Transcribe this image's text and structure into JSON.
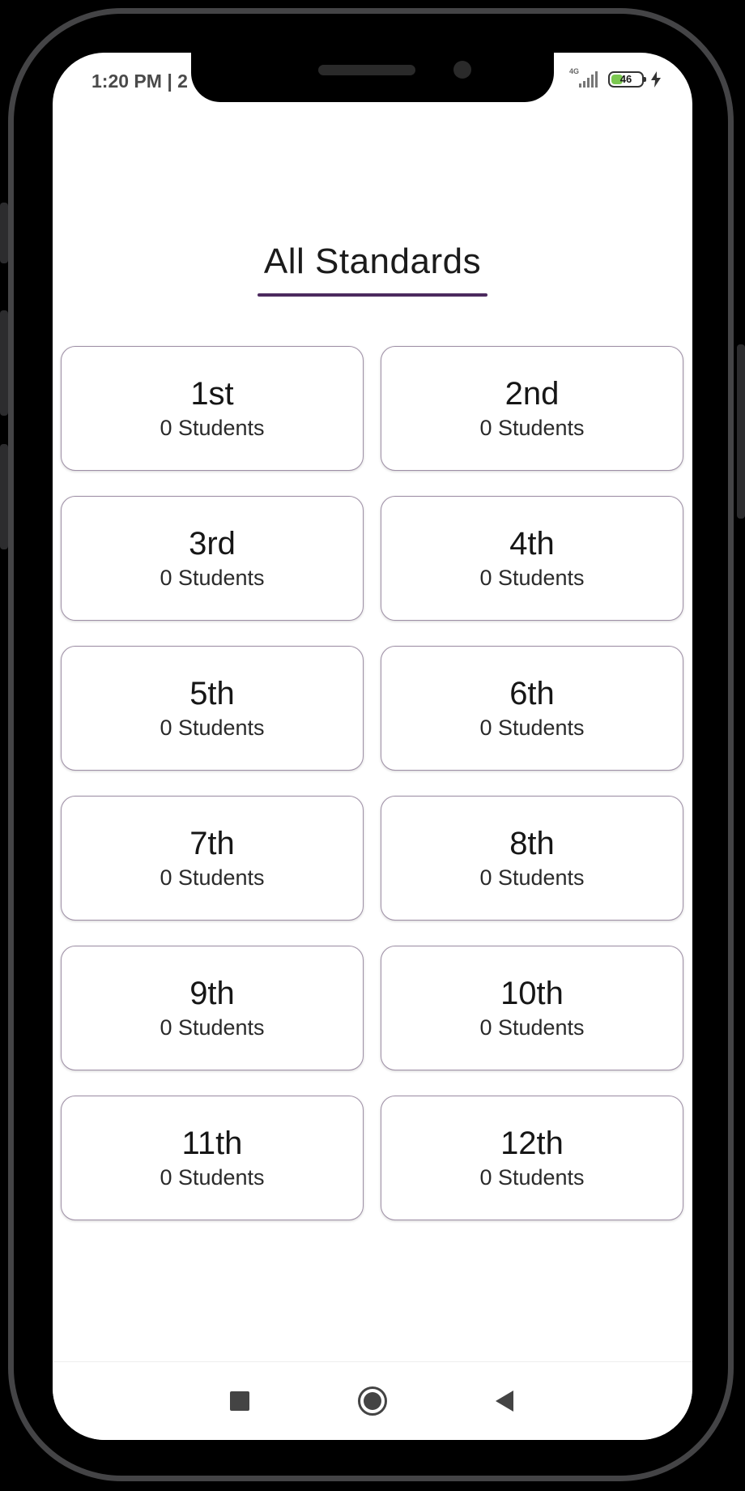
{
  "status_bar": {
    "time": "1:20 PM | 2",
    "network": "4G",
    "battery_level": "46",
    "battery_fraction": 0.46
  },
  "page": {
    "title": "All Standards"
  },
  "standards": [
    {
      "name": "1st",
      "students": "0 Students"
    },
    {
      "name": "2nd",
      "students": "0 Students"
    },
    {
      "name": "3rd",
      "students": "0 Students"
    },
    {
      "name": "4th",
      "students": "0 Students"
    },
    {
      "name": "5th",
      "students": "0 Students"
    },
    {
      "name": "6th",
      "students": "0 Students"
    },
    {
      "name": "7th",
      "students": "0 Students"
    },
    {
      "name": "8th",
      "students": "0 Students"
    },
    {
      "name": "9th",
      "students": "0 Students"
    },
    {
      "name": "10th",
      "students": "0 Students"
    },
    {
      "name": "11th",
      "students": "0 Students"
    },
    {
      "name": "12th",
      "students": "0 Students"
    }
  ],
  "nav_bar": {
    "buttons": [
      "recents-square-icon",
      "home-circle-icon",
      "back-triangle-icon"
    ]
  },
  "colors": {
    "accent": "#4c2a5e",
    "card_border": "#9e8fa6",
    "battery_fill": "#7bc850"
  }
}
